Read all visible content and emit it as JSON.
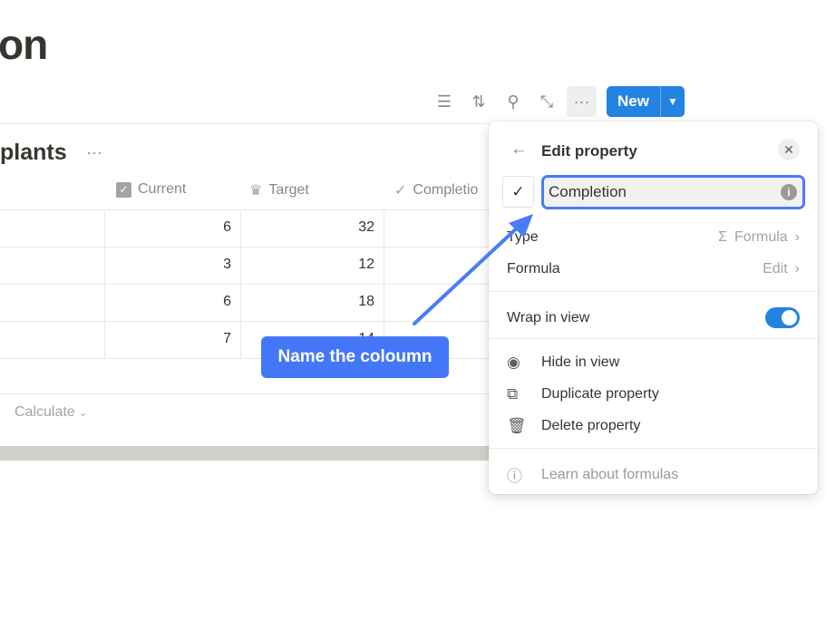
{
  "page": {
    "title": "on"
  },
  "toolbar": {
    "new_label": "New",
    "icons": [
      "filter-icon",
      "sort-icon",
      "search-icon",
      "expand-icon",
      "more-icon"
    ]
  },
  "database": {
    "title": "plants",
    "columns": [
      {
        "label": "Current",
        "icon": "checkbox-icon"
      },
      {
        "label": "Target",
        "icon": "teapot-icon"
      },
      {
        "label": "Completio",
        "icon": "check-icon"
      }
    ],
    "rows": [
      {
        "current": "6",
        "target": "32"
      },
      {
        "current": "3",
        "target": "12"
      },
      {
        "current": "6",
        "target": "18"
      },
      {
        "current": "7",
        "target": "14"
      }
    ],
    "calculate_label": "Calculate"
  },
  "popup": {
    "title": "Edit property",
    "name_value": "Completion",
    "type_label": "Type",
    "type_value": "Formula",
    "formula_label": "Formula",
    "formula_value": "Edit",
    "wrap_label": "Wrap in view",
    "wrap_on": true,
    "hide_label": "Hide in view",
    "duplicate_label": "Duplicate property",
    "delete_label": "Delete property",
    "learn_label": "Learn about formulas"
  },
  "annotation": {
    "text": "Name the coloumn",
    "color": "#4477f8"
  },
  "colors": {
    "accent": "#2383e2",
    "focus": "#4a7cf7"
  }
}
